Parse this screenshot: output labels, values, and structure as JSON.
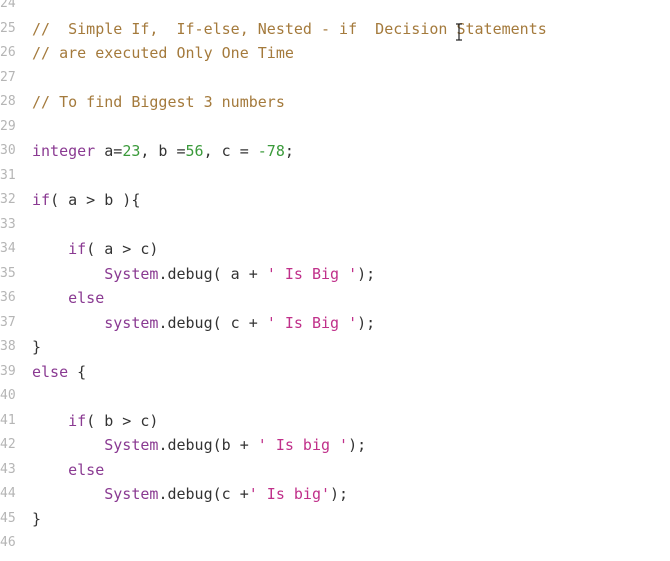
{
  "editor": {
    "cursor_icon": "text-ibeam-cursor",
    "colors": {
      "comment": "#a47a3c",
      "keyword": "#8a3a92",
      "number": "#3a9a3a",
      "string": "#c0308a",
      "text": "#333333",
      "line_number": "#b5b5b5"
    },
    "lines": [
      {
        "num": "24",
        "tokens": []
      },
      {
        "num": "25",
        "tokens": [
          {
            "t": "cm",
            "v": "//  Simple If,  If-else, Nested - if  Decision Statements"
          }
        ]
      },
      {
        "num": "26",
        "tokens": [
          {
            "t": "cm",
            "v": "// are executed Only One Time"
          }
        ]
      },
      {
        "num": "27",
        "tokens": []
      },
      {
        "num": "28",
        "tokens": [
          {
            "t": "cm",
            "v": "// To find Biggest 3 numbers"
          }
        ]
      },
      {
        "num": "29",
        "tokens": []
      },
      {
        "num": "30",
        "tokens": [
          {
            "t": "kw",
            "v": "integer"
          },
          {
            "t": "txt",
            "v": " a="
          },
          {
            "t": "num",
            "v": "23"
          },
          {
            "t": "txt",
            "v": ", b ="
          },
          {
            "t": "num",
            "v": "56"
          },
          {
            "t": "txt",
            "v": ", c = "
          },
          {
            "t": "num",
            "v": "-78"
          },
          {
            "t": "txt",
            "v": ";"
          }
        ]
      },
      {
        "num": "31",
        "tokens": []
      },
      {
        "num": "32",
        "tokens": [
          {
            "t": "kw",
            "v": "if"
          },
          {
            "t": "txt",
            "v": "( a > b ){"
          }
        ]
      },
      {
        "num": "33",
        "tokens": []
      },
      {
        "num": "34",
        "tokens": [
          {
            "t": "txt",
            "v": "    "
          },
          {
            "t": "kw",
            "v": "if"
          },
          {
            "t": "txt",
            "v": "( a > c)"
          }
        ]
      },
      {
        "num": "35",
        "tokens": [
          {
            "t": "txt",
            "v": "        "
          },
          {
            "t": "fn",
            "v": "System"
          },
          {
            "t": "txt",
            "v": ".debug( a + "
          },
          {
            "t": "str",
            "v": "' Is Big '"
          },
          {
            "t": "txt",
            "v": ");"
          }
        ]
      },
      {
        "num": "36",
        "tokens": [
          {
            "t": "txt",
            "v": "    "
          },
          {
            "t": "kw",
            "v": "else"
          }
        ]
      },
      {
        "num": "37",
        "tokens": [
          {
            "t": "txt",
            "v": "        "
          },
          {
            "t": "fn",
            "v": "system"
          },
          {
            "t": "txt",
            "v": ".debug( c + "
          },
          {
            "t": "str",
            "v": "' Is Big '"
          },
          {
            "t": "txt",
            "v": ");"
          }
        ]
      },
      {
        "num": "38",
        "tokens": [
          {
            "t": "txt",
            "v": "}"
          }
        ]
      },
      {
        "num": "39",
        "tokens": [
          {
            "t": "kw",
            "v": "else"
          },
          {
            "t": "txt",
            "v": " {"
          }
        ]
      },
      {
        "num": "40",
        "tokens": []
      },
      {
        "num": "41",
        "tokens": [
          {
            "t": "txt",
            "v": "    "
          },
          {
            "t": "kw",
            "v": "if"
          },
          {
            "t": "txt",
            "v": "( b > c)"
          }
        ]
      },
      {
        "num": "42",
        "tokens": [
          {
            "t": "txt",
            "v": "        "
          },
          {
            "t": "fn",
            "v": "System"
          },
          {
            "t": "txt",
            "v": ".debug(b + "
          },
          {
            "t": "str",
            "v": "' Is big '"
          },
          {
            "t": "txt",
            "v": ");"
          }
        ]
      },
      {
        "num": "43",
        "tokens": [
          {
            "t": "txt",
            "v": "    "
          },
          {
            "t": "kw",
            "v": "else"
          }
        ]
      },
      {
        "num": "44",
        "tokens": [
          {
            "t": "txt",
            "v": "        "
          },
          {
            "t": "fn",
            "v": "System"
          },
          {
            "t": "txt",
            "v": ".debug(c +"
          },
          {
            "t": "str",
            "v": "' Is big'"
          },
          {
            "t": "txt",
            "v": ");"
          }
        ]
      },
      {
        "num": "45",
        "tokens": [
          {
            "t": "txt",
            "v": "}"
          }
        ]
      },
      {
        "num": "46",
        "tokens": []
      }
    ]
  }
}
